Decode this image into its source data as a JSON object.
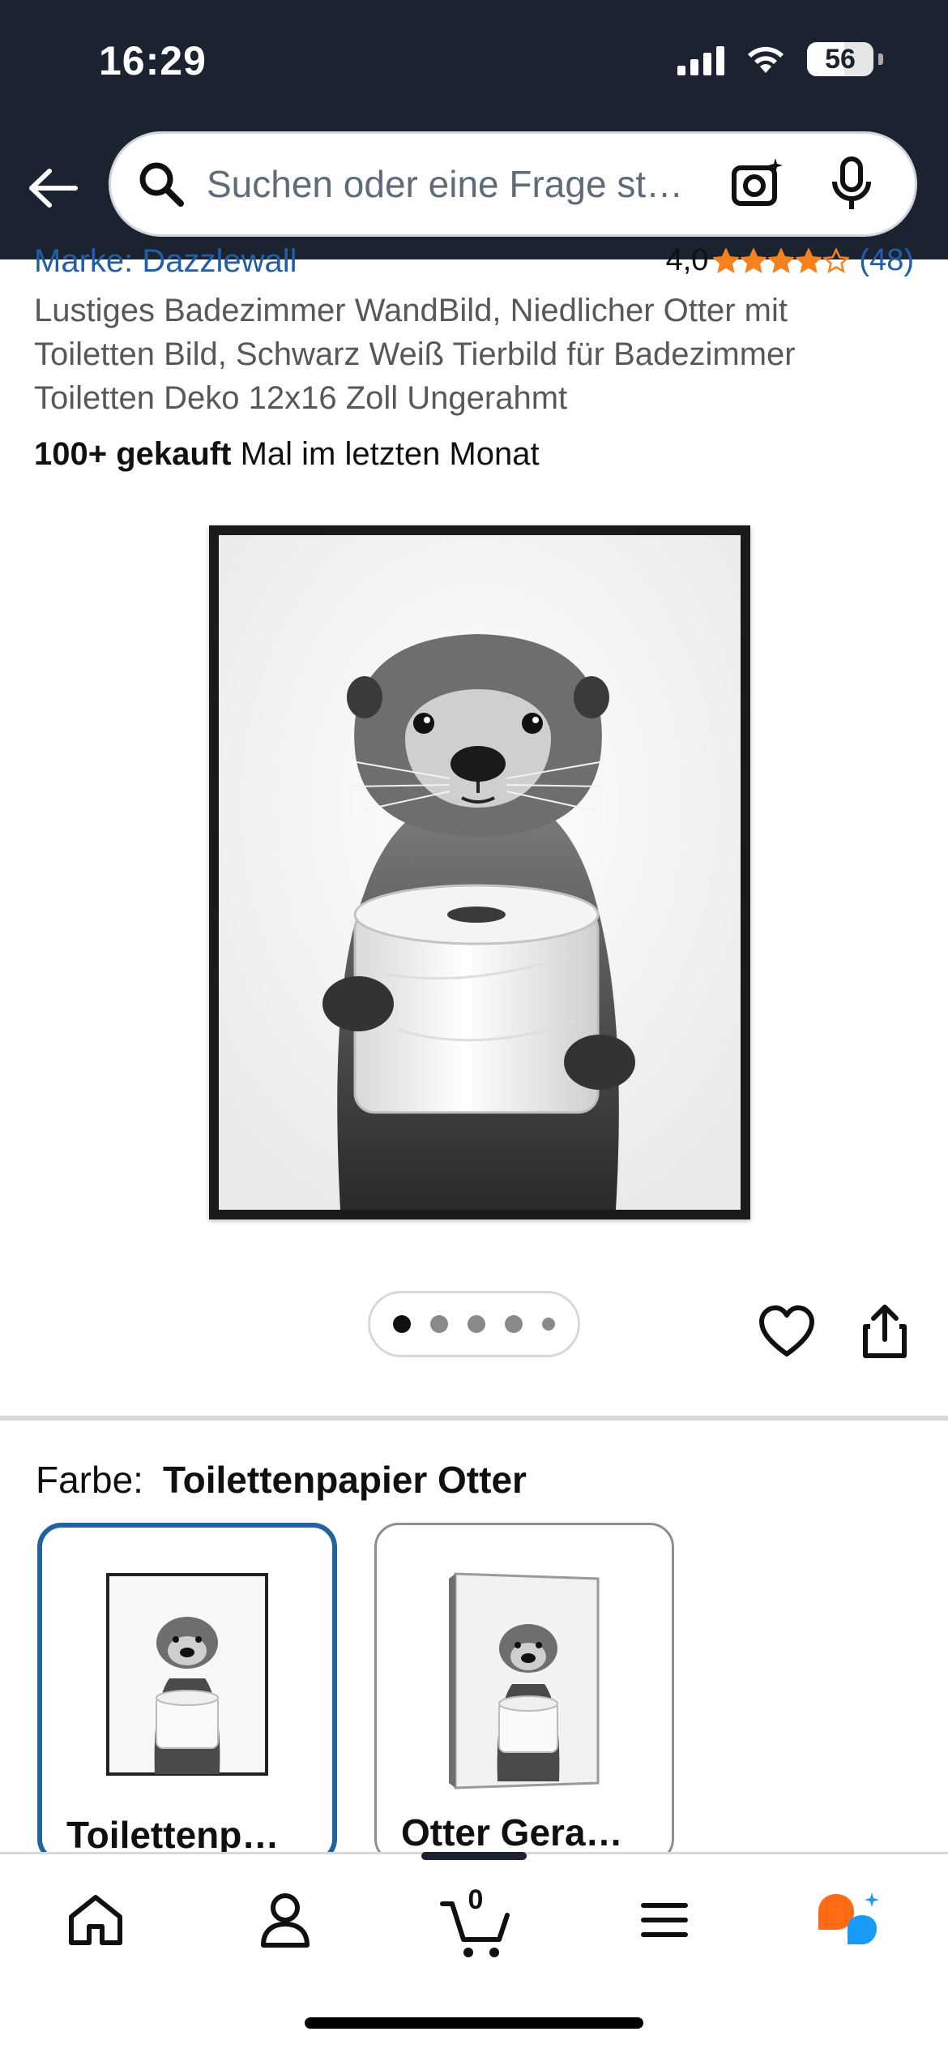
{
  "status_bar": {
    "time": "16:29",
    "battery": "56",
    "battery_level_percent": 56
  },
  "search": {
    "placeholder": "Suchen oder eine Frage st…"
  },
  "product": {
    "brand_label": "Marke: Dazzlewall",
    "rating_value": "4,0",
    "rating_stars": 4,
    "rating_count": "(48)",
    "title": "Lustiges Badezimmer WandBild, Niedlicher Otter mit Toiletten Bild, Schwarz Weiß Tierbild für Badezimmer Toiletten Deko 12x16 Zoll Ungerahmt",
    "bought_bold": "100+ gekauft",
    "bought_rest": " Mal im letzten Monat",
    "image_count": 5,
    "active_image": 1
  },
  "variants": {
    "label": "Farbe:",
    "selected": "Toilettenpapier Otter",
    "options": [
      {
        "name": "Toilettenp…",
        "selected": true
      },
      {
        "name": "Otter Gera…",
        "selected": false
      }
    ]
  },
  "bottom_nav": {
    "items": [
      "home-icon",
      "account-icon",
      "cart-icon",
      "menu-icon",
      "rufus-icon"
    ],
    "cart_count": "0"
  },
  "colors": {
    "header_bg": "#1b2331",
    "link_blue": "#1f5ea8",
    "star_orange": "#f6821f",
    "selected_border": "#2162a1",
    "rufus_orange": "#ff6a14",
    "rufus_blue": "#1a9bf5"
  }
}
